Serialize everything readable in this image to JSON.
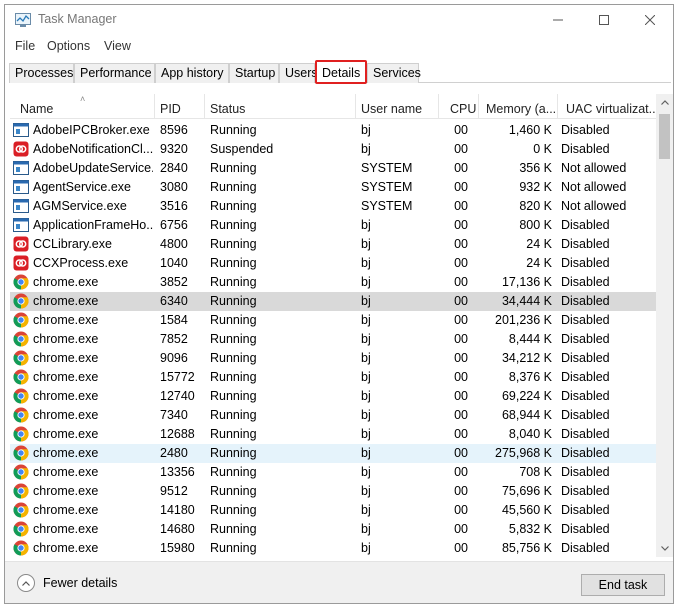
{
  "window": {
    "title": "Task Manager"
  },
  "menu": [
    "File",
    "Options",
    "View"
  ],
  "tabs": [
    "Processes",
    "Performance",
    "App history",
    "Startup",
    "Users",
    "Details",
    "Services"
  ],
  "active_tab": "Details",
  "columns": [
    "Name",
    "PID",
    "Status",
    "User name",
    "CPU",
    "Memory (a...",
    "UAC virtualizat..."
  ],
  "rows": [
    {
      "name": "AdobeIPCBroker.exe",
      "pid": "8596",
      "status": "Running",
      "user": "bj",
      "cpu": "00",
      "mem": "1,460 K",
      "uac": "Disabled",
      "icon": "window-icon"
    },
    {
      "name": "AdobeNotificationCl...",
      "pid": "9320",
      "status": "Suspended",
      "user": "bj",
      "cpu": "00",
      "mem": "0 K",
      "uac": "Disabled",
      "icon": "adobe-icon"
    },
    {
      "name": "AdobeUpdateService...",
      "pid": "2840",
      "status": "Running",
      "user": "SYSTEM",
      "cpu": "00",
      "mem": "356 K",
      "uac": "Not allowed",
      "icon": "window-icon"
    },
    {
      "name": "AgentService.exe",
      "pid": "3080",
      "status": "Running",
      "user": "SYSTEM",
      "cpu": "00",
      "mem": "932 K",
      "uac": "Not allowed",
      "icon": "window-icon"
    },
    {
      "name": "AGMService.exe",
      "pid": "3516",
      "status": "Running",
      "user": "SYSTEM",
      "cpu": "00",
      "mem": "820 K",
      "uac": "Not allowed",
      "icon": "window-icon"
    },
    {
      "name": "ApplicationFrameHo...",
      "pid": "6756",
      "status": "Running",
      "user": "bj",
      "cpu": "00",
      "mem": "800 K",
      "uac": "Disabled",
      "icon": "window-icon"
    },
    {
      "name": "CCLibrary.exe",
      "pid": "4800",
      "status": "Running",
      "user": "bj",
      "cpu": "00",
      "mem": "24 K",
      "uac": "Disabled",
      "icon": "adobe-icon"
    },
    {
      "name": "CCXProcess.exe",
      "pid": "1040",
      "status": "Running",
      "user": "bj",
      "cpu": "00",
      "mem": "24 K",
      "uac": "Disabled",
      "icon": "adobe-icon"
    },
    {
      "name": "chrome.exe",
      "pid": "3852",
      "status": "Running",
      "user": "bj",
      "cpu": "00",
      "mem": "17,136 K",
      "uac": "Disabled",
      "icon": "chrome-icon"
    },
    {
      "name": "chrome.exe",
      "pid": "6340",
      "status": "Running",
      "user": "bj",
      "cpu": "00",
      "mem": "34,444 K",
      "uac": "Disabled",
      "icon": "chrome-icon",
      "state": "selected"
    },
    {
      "name": "chrome.exe",
      "pid": "1584",
      "status": "Running",
      "user": "bj",
      "cpu": "00",
      "mem": "201,236 K",
      "uac": "Disabled",
      "icon": "chrome-icon"
    },
    {
      "name": "chrome.exe",
      "pid": "7852",
      "status": "Running",
      "user": "bj",
      "cpu": "00",
      "mem": "8,444 K",
      "uac": "Disabled",
      "icon": "chrome-icon"
    },
    {
      "name": "chrome.exe",
      "pid": "9096",
      "status": "Running",
      "user": "bj",
      "cpu": "00",
      "mem": "34,212 K",
      "uac": "Disabled",
      "icon": "chrome-icon"
    },
    {
      "name": "chrome.exe",
      "pid": "15772",
      "status": "Running",
      "user": "bj",
      "cpu": "00",
      "mem": "8,376 K",
      "uac": "Disabled",
      "icon": "chrome-icon"
    },
    {
      "name": "chrome.exe",
      "pid": "12740",
      "status": "Running",
      "user": "bj",
      "cpu": "00",
      "mem": "69,224 K",
      "uac": "Disabled",
      "icon": "chrome-icon"
    },
    {
      "name": "chrome.exe",
      "pid": "7340",
      "status": "Running",
      "user": "bj",
      "cpu": "00",
      "mem": "68,944 K",
      "uac": "Disabled",
      "icon": "chrome-icon"
    },
    {
      "name": "chrome.exe",
      "pid": "12688",
      "status": "Running",
      "user": "bj",
      "cpu": "00",
      "mem": "8,040 K",
      "uac": "Disabled",
      "icon": "chrome-icon"
    },
    {
      "name": "chrome.exe",
      "pid": "2480",
      "status": "Running",
      "user": "bj",
      "cpu": "00",
      "mem": "275,968 K",
      "uac": "Disabled",
      "icon": "chrome-icon",
      "state": "hover"
    },
    {
      "name": "chrome.exe",
      "pid": "13356",
      "status": "Running",
      "user": "bj",
      "cpu": "00",
      "mem": "708 K",
      "uac": "Disabled",
      "icon": "chrome-icon"
    },
    {
      "name": "chrome.exe",
      "pid": "9512",
      "status": "Running",
      "user": "bj",
      "cpu": "00",
      "mem": "75,696 K",
      "uac": "Disabled",
      "icon": "chrome-icon"
    },
    {
      "name": "chrome.exe",
      "pid": "14180",
      "status": "Running",
      "user": "bj",
      "cpu": "00",
      "mem": "45,560 K",
      "uac": "Disabled",
      "icon": "chrome-icon"
    },
    {
      "name": "chrome.exe",
      "pid": "14680",
      "status": "Running",
      "user": "bj",
      "cpu": "00",
      "mem": "5,832 K",
      "uac": "Disabled",
      "icon": "chrome-icon"
    },
    {
      "name": "chrome.exe",
      "pid": "15980",
      "status": "Running",
      "user": "bj",
      "cpu": "00",
      "mem": "85,756 K",
      "uac": "Disabled",
      "icon": "chrome-icon"
    }
  ],
  "footer": {
    "fewer_details": "Fewer details",
    "end_task": "End task"
  },
  "colors": {
    "active_tab_outline": "#e02020",
    "selected_row": "#d9d9d9",
    "hover_row": "#e5f3fb"
  }
}
